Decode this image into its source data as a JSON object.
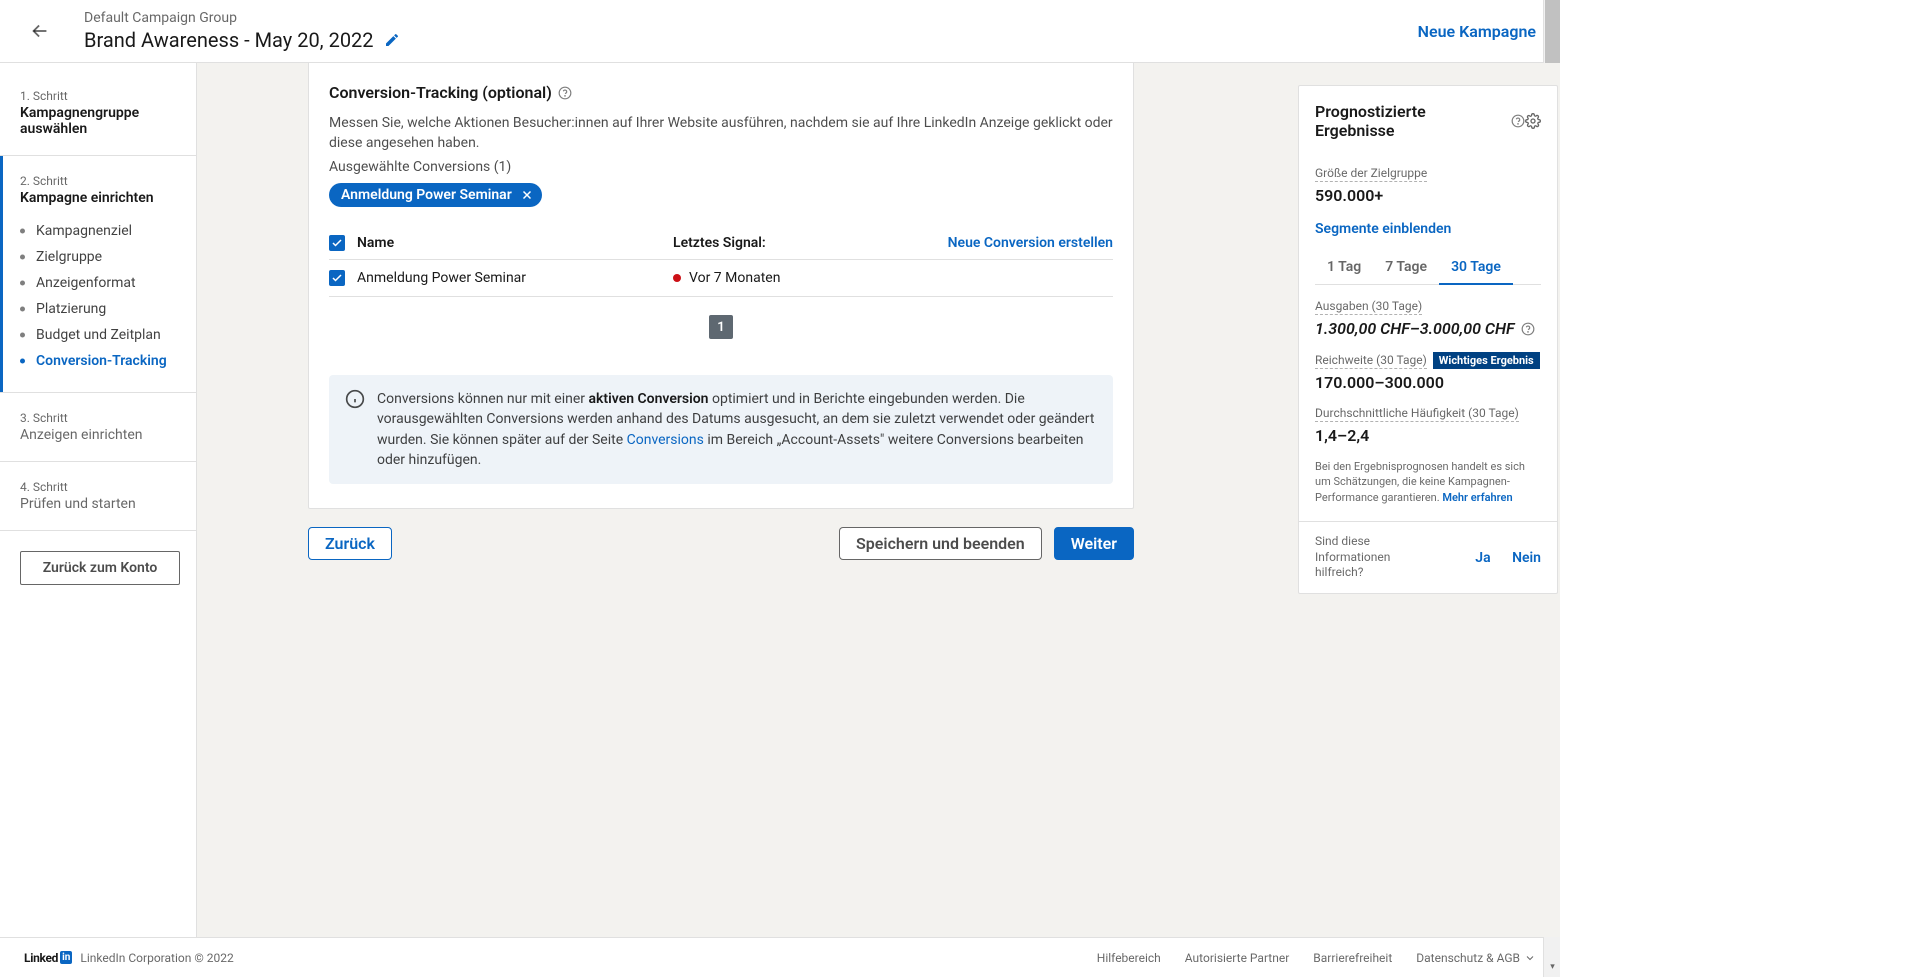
{
  "header": {
    "breadcrumb": "Default Campaign Group",
    "title": "Brand Awareness - May 20, 2022",
    "new_campaign": "Neue Kampagne"
  },
  "sidebar": {
    "steps": [
      {
        "label": "1. Schritt",
        "title": "Kampagnengruppe auswählen"
      },
      {
        "label": "2. Schritt",
        "title": "Kampagne einrichten"
      },
      {
        "label": "3. Schritt",
        "title": "Anzeigen einrichten"
      },
      {
        "label": "4. Schritt",
        "title": "Prüfen und starten"
      }
    ],
    "substeps": [
      "Kampagnenziel",
      "Zielgruppe",
      "Anzeigenformat",
      "Platzierung",
      "Budget und Zeitplan",
      "Conversion-Tracking"
    ],
    "back_account": "Zurück zum Konto"
  },
  "conversion": {
    "title": "Conversion-Tracking (optional)",
    "desc": "Messen Sie, welche Aktionen Besucher:innen auf Ihrer Website ausführen, nachdem sie auf Ihre LinkedIn Anzeige geklickt oder diese angesehen haben.",
    "selected_label": "Ausgewählte Conversions (1)",
    "pill": "Anmeldung Power Seminar",
    "table": {
      "col_name": "Name",
      "col_signal": "Letztes Signal:",
      "create": "Neue Conversion erstellen",
      "rows": [
        {
          "name": "Anmeldung Power Seminar",
          "signal": "Vor 7 Monaten"
        }
      ],
      "page": "1"
    },
    "info_pre": "Conversions können nur mit einer ",
    "info_bold": "aktiven Conversion",
    "info_mid": " optimiert und in Berichte eingebunden werden. Die vorausgewählten Conversions werden anhand des Datums ausgesucht, an dem sie zuletzt verwendet oder geändert wurden. Sie können später auf der Seite ",
    "info_link": "Conversions",
    "info_post": " im Bereich „Account-Assets\" weitere Conversions bearbeiten oder hinzufügen."
  },
  "buttons": {
    "back": "Zurück",
    "save": "Speichern und beenden",
    "next": "Weiter"
  },
  "forecast": {
    "title": "Prognostizierte Ergebnisse",
    "audience_label": "Größe der Zielgruppe",
    "audience_value": "590.000+",
    "segments": "Segmente einblenden",
    "tabs": [
      "1 Tag",
      "7 Tage",
      "30 Tage"
    ],
    "spend_label": "Ausgaben (30 Tage)",
    "spend_value": "1.300,00 CHF–3.000,00 CHF",
    "reach_label": "Reichweite (30 Tage)",
    "reach_badge": "Wichtiges Ergebnis",
    "reach_value": "170.000–300.000",
    "freq_label": "Durchschnittliche Häufigkeit (30 Tage)",
    "freq_value": "1,4–2,4",
    "disclaimer": "Bei den Ergebnisprognosen handelt es sich um Schätzungen, die keine Kampagnen-Performance garantieren. ",
    "disclaimer_link": "Mehr erfahren",
    "feedback_q": "Sind diese Informationen hilfreich?",
    "yes": "Ja",
    "no": "Nein"
  },
  "footer": {
    "brand_pre": "Linked",
    "brand_in": "in",
    "copyright": "LinkedIn Corporation © 2022",
    "links": [
      "Hilfebereich",
      "Autorisierte Partner",
      "Barrierefreiheit",
      "Datenschutz & AGB"
    ]
  }
}
